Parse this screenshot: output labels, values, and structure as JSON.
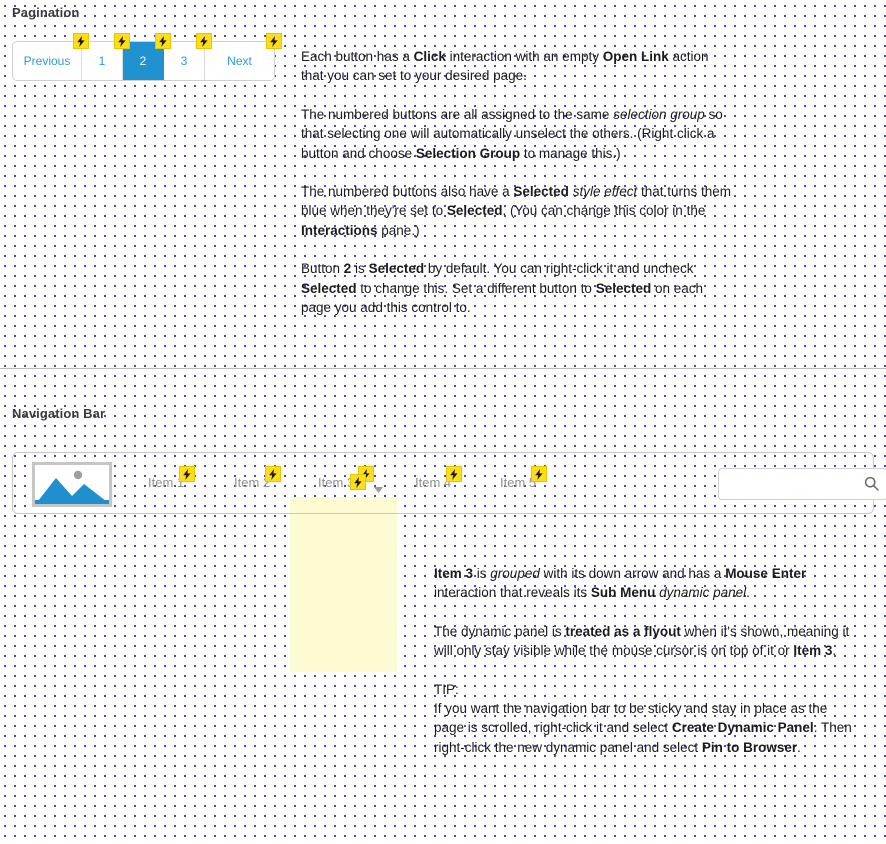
{
  "sections": {
    "pagination_label": "Pagination",
    "navbar_label": "Navigation Bar"
  },
  "colors": {
    "selected_blue": "#2092d0",
    "link_blue": "#2e9bd6",
    "badge_yellow": "#ffdd17",
    "panel_yellow": "#fcfbd2",
    "grid_dot": "#1a1ab4",
    "placeholder_gray": "#8f8f8f"
  },
  "pagination": {
    "buttons": [
      {
        "label": "Previous",
        "selected": false,
        "has_interaction_badge": true
      },
      {
        "label": "1",
        "selected": false,
        "has_interaction_badge": true
      },
      {
        "label": "2",
        "selected": true,
        "has_interaction_badge": true
      },
      {
        "label": "3",
        "selected": false,
        "has_interaction_badge": true
      },
      {
        "label": "Next",
        "selected": false,
        "has_interaction_badge": true
      }
    ],
    "notes": [
      {
        "runs": [
          {
            "t": "Each button has a ",
            "s": "n"
          },
          {
            "t": "Click",
            "s": "b"
          },
          {
            "t": " interaction with an empty ",
            "s": "n"
          },
          {
            "t": "Open Link",
            "s": "b"
          },
          {
            "t": " action that you can set to your desired page.",
            "s": "n"
          }
        ]
      },
      {
        "runs": [
          {
            "t": "The numbered buttons are all assigned to the same ",
            "s": "n"
          },
          {
            "t": "selection group",
            "s": "i"
          },
          {
            "t": " so that selecting one will automatically unselect the others. (Right click a button and choose ",
            "s": "n"
          },
          {
            "t": "Selection Group",
            "s": "b"
          },
          {
            "t": " to manage this.)",
            "s": "n"
          }
        ]
      },
      {
        "runs": [
          {
            "t": "The numbered buttons also have a ",
            "s": "n"
          },
          {
            "t": "Selected",
            "s": "b"
          },
          {
            "t": " ",
            "s": "n"
          },
          {
            "t": "style effect",
            "s": "i"
          },
          {
            "t": " that turns them blue when they're set to ",
            "s": "n"
          },
          {
            "t": "Selected",
            "s": "b"
          },
          {
            "t": ". (You can change this color in the ",
            "s": "n"
          },
          {
            "t": "Interactions",
            "s": "b"
          },
          {
            "t": " pane.)",
            "s": "n"
          }
        ]
      },
      {
        "runs": [
          {
            "t": "Button ",
            "s": "n"
          },
          {
            "t": "2",
            "s": "b"
          },
          {
            "t": " is ",
            "s": "n"
          },
          {
            "t": "Selected",
            "s": "b"
          },
          {
            "t": " by default. You can right-click it and uncheck ",
            "s": "n"
          },
          {
            "t": "Selected",
            "s": "b"
          },
          {
            "t": " to change this. Set a different button to ",
            "s": "n"
          },
          {
            "t": "Selected",
            "s": "b"
          },
          {
            "t": " on each page you add this control to.",
            "s": "n"
          }
        ]
      }
    ]
  },
  "navbar": {
    "logo_alt": "image-placeholder",
    "items": [
      {
        "label": "Item 1",
        "badges": 1,
        "has_arrow": false
      },
      {
        "label": "Item 2",
        "badges": 1,
        "has_arrow": false
      },
      {
        "label": "Item 3",
        "badges": 2,
        "has_arrow": true
      },
      {
        "label": "Item 4",
        "badges": 1,
        "has_arrow": false
      },
      {
        "label": "Item 5",
        "badges": 1,
        "has_arrow": false
      }
    ],
    "search": {
      "value": "",
      "placeholder": "",
      "icon": "search-icon"
    },
    "submenu_panel": {
      "name": "Sub Menu",
      "visible": true
    },
    "notes": [
      {
        "runs": [
          {
            "t": "Item 3",
            "s": "b"
          },
          {
            "t": " is ",
            "s": "n"
          },
          {
            "t": "grouped",
            "s": "i"
          },
          {
            "t": " with its down arrow and has a ",
            "s": "n"
          },
          {
            "t": "Mouse Enter",
            "s": "b"
          },
          {
            "t": " interaction that reveals its ",
            "s": "n"
          },
          {
            "t": "Sub Menu",
            "s": "b"
          },
          {
            "t": " ",
            "s": "n"
          },
          {
            "t": "dynamic panel",
            "s": "i"
          },
          {
            "t": ".",
            "s": "n"
          }
        ]
      },
      {
        "runs": [
          {
            "t": "The dynamic panel is ",
            "s": "n"
          },
          {
            "t": "treated as a flyout",
            "s": "b"
          },
          {
            "t": " when it's shown, meaning it will only stay visible while the mouse cursor is on top of it or ",
            "s": "n"
          },
          {
            "t": "Item 3",
            "s": "b"
          },
          {
            "t": ".",
            "s": "n"
          }
        ]
      },
      {
        "runs": [
          {
            "t": "TIP:\nIf you want the navigation bar to be sticky and stay in place as the page is scrolled, right-click it and select ",
            "s": "n"
          },
          {
            "t": "Create Dynamic Panel",
            "s": "b"
          },
          {
            "t": ". Then right-click the new dynamic panel and select ",
            "s": "n"
          },
          {
            "t": "Pin to Browser",
            "s": "b"
          },
          {
            "t": ".",
            "s": "n"
          }
        ]
      }
    ]
  }
}
